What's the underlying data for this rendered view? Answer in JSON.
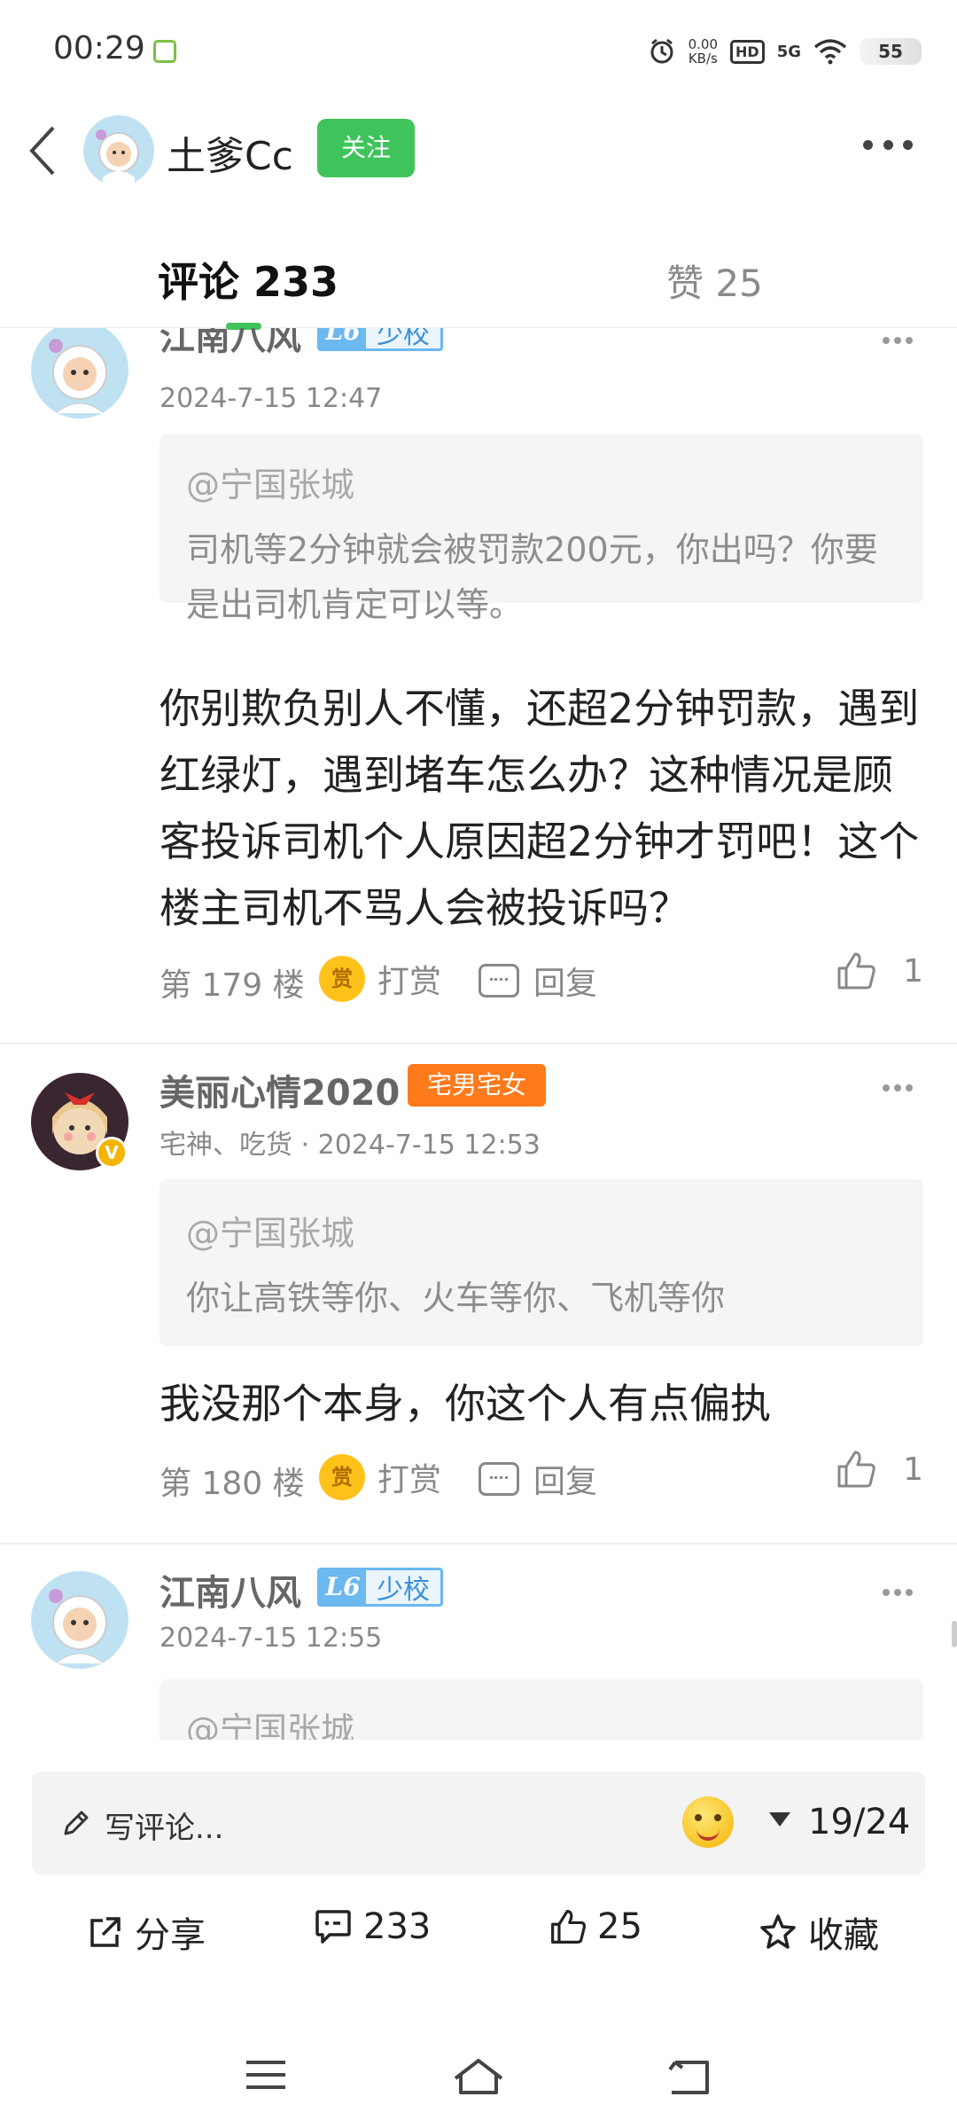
{
  "status_bar": {
    "time": "00:29",
    "net_speed_value": "0.00",
    "net_speed_unit": "KB/s",
    "hd": "HD",
    "signal": "5G",
    "battery": "55"
  },
  "header": {
    "username": "土爹Cc",
    "follow_label": "关注"
  },
  "tabs": {
    "comments": "评论 233",
    "likes": "赞 25"
  },
  "comments": [
    {
      "username": "江南八风",
      "level_mark": "L6",
      "level_title": "少校",
      "meta": "2024-7-15 12:47",
      "quote_user": "@宁国张城",
      "quote_text": "司机等2分钟就会被罚款200元，你出吗？你要是出司机肯定可以等。",
      "text": "你别欺负别人不懂，还超2分钟罚款，遇到红绿灯，遇到堵车怎么办？这种情况是顾客投诉司机个人原因超2分钟才罚吧！这个楼主司机不骂人会被投诉吗？",
      "floor": "第 179 楼",
      "reward": "打赏",
      "reward_icon": "赏",
      "reply": "回复",
      "likes": "1"
    },
    {
      "username": "美丽心情2020",
      "tag": "宅男宅女",
      "verified": "V",
      "meta": "宅神、吃货 · 2024-7-15 12:53",
      "quote_user": "@宁国张城",
      "quote_text": "你让高铁等你、火车等你、飞机等你",
      "text": "我没那个本身，你这个人有点偏执",
      "floor": "第 180 楼",
      "reward": "打赏",
      "reward_icon": "赏",
      "reply": "回复",
      "likes": "1"
    },
    {
      "username": "江南八风",
      "level_mark": "L6",
      "level_title": "少校",
      "meta": "2024-7-15 12:55",
      "quote_user": "@宁国张城"
    }
  ],
  "input_bar": {
    "placeholder": "写评论...",
    "page": "19/24"
  },
  "bottom_actions": {
    "share": "分享",
    "comments": "233",
    "likes": "25",
    "favorite": "收藏"
  }
}
